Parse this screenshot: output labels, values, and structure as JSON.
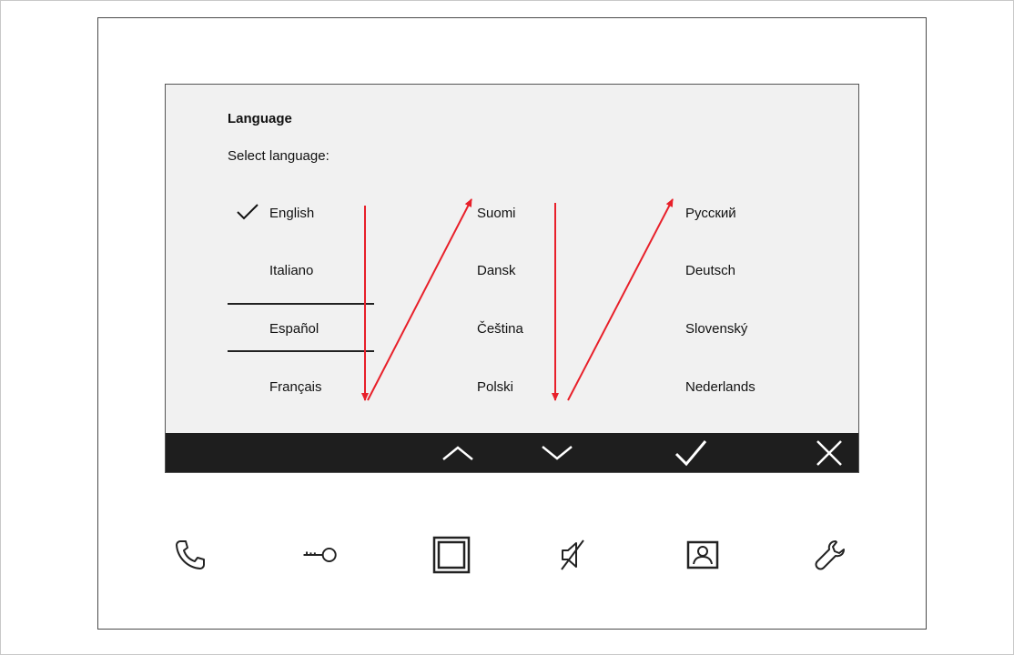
{
  "screen": {
    "title": "Language",
    "subtitle": "Select language:"
  },
  "languages": {
    "column1": [
      "English",
      "Italiano",
      "Español",
      "Français"
    ],
    "column2": [
      "Suomi",
      "Dansk",
      "Čeština",
      "Polski"
    ],
    "column3": [
      "Русский",
      "Deutsch",
      "Slovenský",
      "Nederlands"
    ],
    "selected": "English",
    "highlighted": "Español"
  },
  "softkeys": {
    "icons": [
      "chevron-up-icon",
      "chevron-down-icon",
      "checkmark-icon",
      "close-icon"
    ]
  },
  "hardware_buttons": {
    "icons": [
      "phone-icon",
      "key-icon",
      "square-icon",
      "mute-icon",
      "intercom-icon",
      "wrench-icon"
    ]
  },
  "colors": {
    "annotation_arrow": "#e8202a",
    "softkey_bar": "#1e1e1e",
    "screen_background": "#f1f1f1"
  }
}
